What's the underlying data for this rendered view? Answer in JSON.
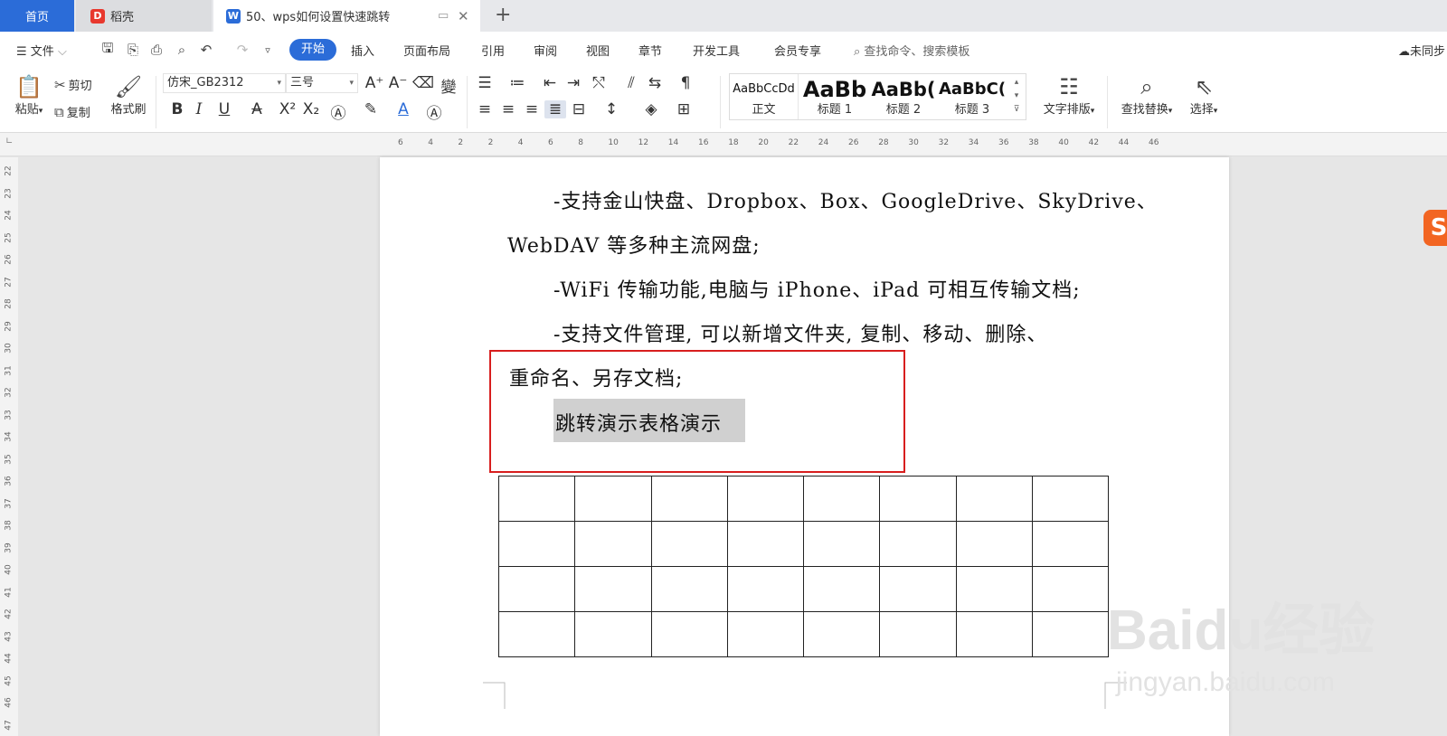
{
  "tabs": {
    "home": "首页",
    "docer": "稻壳",
    "doc": "50、wps如何设置快速跳转"
  },
  "menu": {
    "file": "文件",
    "start": "开始",
    "insert": "插入",
    "layout": "页面布局",
    "reference": "引用",
    "review": "审阅",
    "view": "视图",
    "section": "章节",
    "devtools": "开发工具",
    "member": "会员专享",
    "search_placeholder": "查找命令、搜索模板",
    "cloud": "未同步"
  },
  "toolbar": {
    "paste": "粘贴",
    "cut": "剪切",
    "copy": "复制",
    "format_painter": "格式刷",
    "font_name": "仿宋_GB2312",
    "font_size": "三号",
    "text_layout": "文字排版",
    "find_replace": "查找替换",
    "select": "选择"
  },
  "styles": [
    {
      "preview": "AaBbCcDd",
      "name": "正文"
    },
    {
      "preview": "AaBb",
      "name": "标题 1"
    },
    {
      "preview": "AaBb(",
      "name": "标题 2"
    },
    {
      "preview": "AaBbC(",
      "name": "标题 3"
    }
  ],
  "ruler": [
    "6",
    "4",
    "2",
    "2",
    "4",
    "6",
    "8",
    "10",
    "12",
    "14",
    "16",
    "18",
    "20",
    "22",
    "24",
    "26",
    "28",
    "30",
    "32",
    "34",
    "36",
    "38",
    "40",
    "42",
    "44",
    "46"
  ],
  "vruler": [
    "22",
    "23",
    "24",
    "25",
    "26",
    "27",
    "28",
    "29",
    "30",
    "31",
    "32",
    "33",
    "34",
    "35",
    "36",
    "37",
    "38",
    "39",
    "40",
    "41",
    "42",
    "43",
    "44",
    "45",
    "46",
    "47"
  ],
  "document": {
    "line1": "-支持金山快盘、Dropbox、Box、GoogleDrive、SkyDrive、",
    "line2": "WebDAV 等多种主流网盘;",
    "line3": "-WiFi 传输功能,电脑与 iPhone、iPad 可相互传输文档;",
    "line4": "-支持文件管理, 可以新增文件夹, 复制、移动、删除、",
    "line5": "重命名、另存文档;",
    "highlight": "跳转演示表格演示"
  },
  "table": {
    "rows": 4,
    "cols": 8
  },
  "watermark": {
    "brand": "Baidu经验",
    "url": "jingyan.baidu.com"
  },
  "colors": {
    "accent": "#2b6cd8",
    "annotation": "#d81e1e",
    "highlight": "#d0d0d0"
  }
}
